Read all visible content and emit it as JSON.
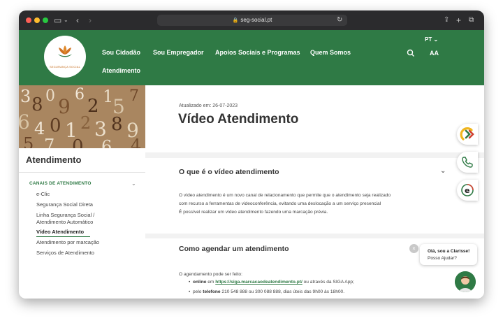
{
  "browser": {
    "url": "seg-social.pt"
  },
  "header": {
    "logo_text": "SEGURANÇA SOCIAL",
    "nav": [
      "Sou Cidadão",
      "Sou Empregador",
      "Apoios Sociais e Programas",
      "Quem Somos",
      "Atendimento"
    ],
    "lang": "PT ⌄",
    "text_size": "AA"
  },
  "sidebar": {
    "title": "Atendimento",
    "category": "CANAIS DE ATENDIMENTO",
    "items": [
      "e-Clic",
      "Segurança Social Direta",
      "Linha Segurança Social /",
      "Atendimento Automático",
      "Vídeo Atendimento",
      "Atendimento por marcação",
      "Serviços de Atendimento"
    ]
  },
  "main": {
    "updated": "Atualizado em: 26-07-2023",
    "title": "Vídeo Atendimento",
    "section1_title": "O que é o vídeo atendimento",
    "section1_lines": [
      "O vídeo atendimento é um novo canal de relacionamento que permite que o atendimento seja realizado",
      "com recurso a ferramentas de videoconferência, evitando uma deslocação a um serviço presencial",
      "É possível realizar um vídeo atendimento fazendo uma marcação prévia."
    ],
    "section2_title": "Como agendar um atendimento",
    "section2_intro": "O agendamento pode ser feito:",
    "bullet1_bold": "online",
    "bullet1_mid": " em ",
    "bullet1_link": "https://siga.marcacaodeatendimento.pt/",
    "bullet1_end": " ou através da SIGA App;",
    "bullet2_start": "pelo ",
    "bullet2_bold": "telefone",
    "bullet2_end": " 210 548 888 ou 300 088 888, dias úteis das 9h00 às 18h00."
  },
  "chat": {
    "line1": "Olá, sou a Clarisse!",
    "line2": "Posso Ajudar?",
    "close": "×"
  },
  "colors": {
    "brand_green": "#2f7a45",
    "logo_orange": "#c56d1e"
  }
}
